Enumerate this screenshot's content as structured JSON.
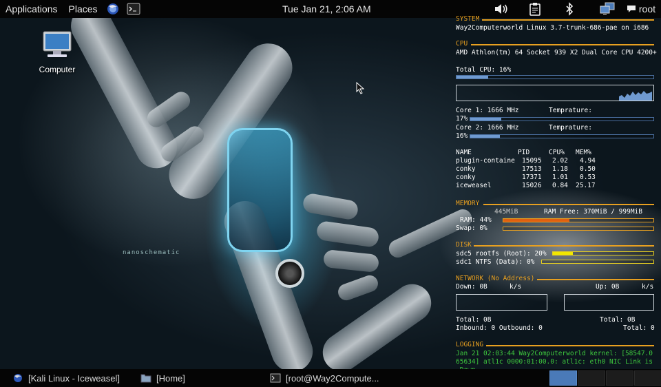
{
  "top_panel": {
    "applications_label": "Applications",
    "places_label": "Places",
    "clock": "Tue Jan 21,  2:06 AM",
    "user": "root"
  },
  "desktop": {
    "computer_label": "Computer"
  },
  "conky": {
    "system": {
      "title": "SYSTEM",
      "line": "Way2Computerworld Linux 3.7-trunk-686-pae on i686"
    },
    "cpu": {
      "title": "CPU",
      "model": "AMD Athlon(tm) 64 Socket 939 X2 Dual Core CPU 4200+",
      "total_label": "Total CPU: 16%",
      "total_percent": 16,
      "core1_label": "Core 1: 1666 MHz",
      "core1_percent_label": "17%",
      "core1_percent": 17,
      "core2_label": "Core 2: 1666 MHz",
      "core2_percent_label": "16%",
      "core2_percent": 16,
      "temp_label": "Temprature:"
    },
    "processes": {
      "headers": [
        "NAME",
        "PID",
        "CPU%",
        "MEM%"
      ],
      "rows": [
        [
          "plugin-containe",
          "15095",
          "2.02",
          "4.94"
        ],
        [
          "conky",
          "17513",
          "1.18",
          "0.50"
        ],
        [
          "conky",
          "17371",
          "1.01",
          "0.53"
        ],
        [
          "iceweasel",
          "15026",
          "0.84",
          "25.17"
        ]
      ]
    },
    "memory": {
      "title": "MEMORY",
      "ram_used": "445MiB",
      "ram_free": "RAM Free: 370MiB / 999MiB",
      "ram_label": "RAM: 44%",
      "ram_percent": 44,
      "swap_label": "Swap: 0%",
      "swap_percent": 0
    },
    "disk": {
      "title": "DISK",
      "root_label": "sdc5 rootfs (Root): 20%",
      "root_percent": 20,
      "data_label": "sdc1 NTFS (Data): 0%",
      "data_percent": 0
    },
    "network": {
      "title": "NETWORK (No Address)",
      "down_label": "Down: 0B",
      "down_unit": "k/s",
      "up_label": "Up: 0B",
      "up_unit": "k/s",
      "total_down": "Total: 0B",
      "total_up": "Total: 0B",
      "inbound": "Inbound: 0 Outbound: 0",
      "total_conn": "Total: 0"
    },
    "logging": {
      "title": "LOGGING",
      "lines": [
        "Jan 21 02:03:44 Way2Computerworld kernel: [58547.0",
        "65634] atl1c 0000:01:00.0: atl1c: eth0 NIC Link is",
        " Down"
      ]
    },
    "colors": {
      "section": "#e8a020",
      "bar": "#6f9ad0",
      "ram_bar": "#e06010",
      "disk_bar": "#f2e800",
      "log": "#3ec83e"
    }
  },
  "wallpaper": {
    "overlay_text": "nanoschematic"
  },
  "bottom_panel": {
    "tasks": [
      {
        "label": "[Kali Linux - Iceweasel]",
        "icon": "iceweasel-icon"
      },
      {
        "label": "[Home]",
        "icon": "folder-icon"
      },
      {
        "label": "[root@Way2Compute...",
        "icon": "terminal-icon"
      }
    ],
    "workspaces": [
      true,
      false,
      false,
      false
    ]
  }
}
